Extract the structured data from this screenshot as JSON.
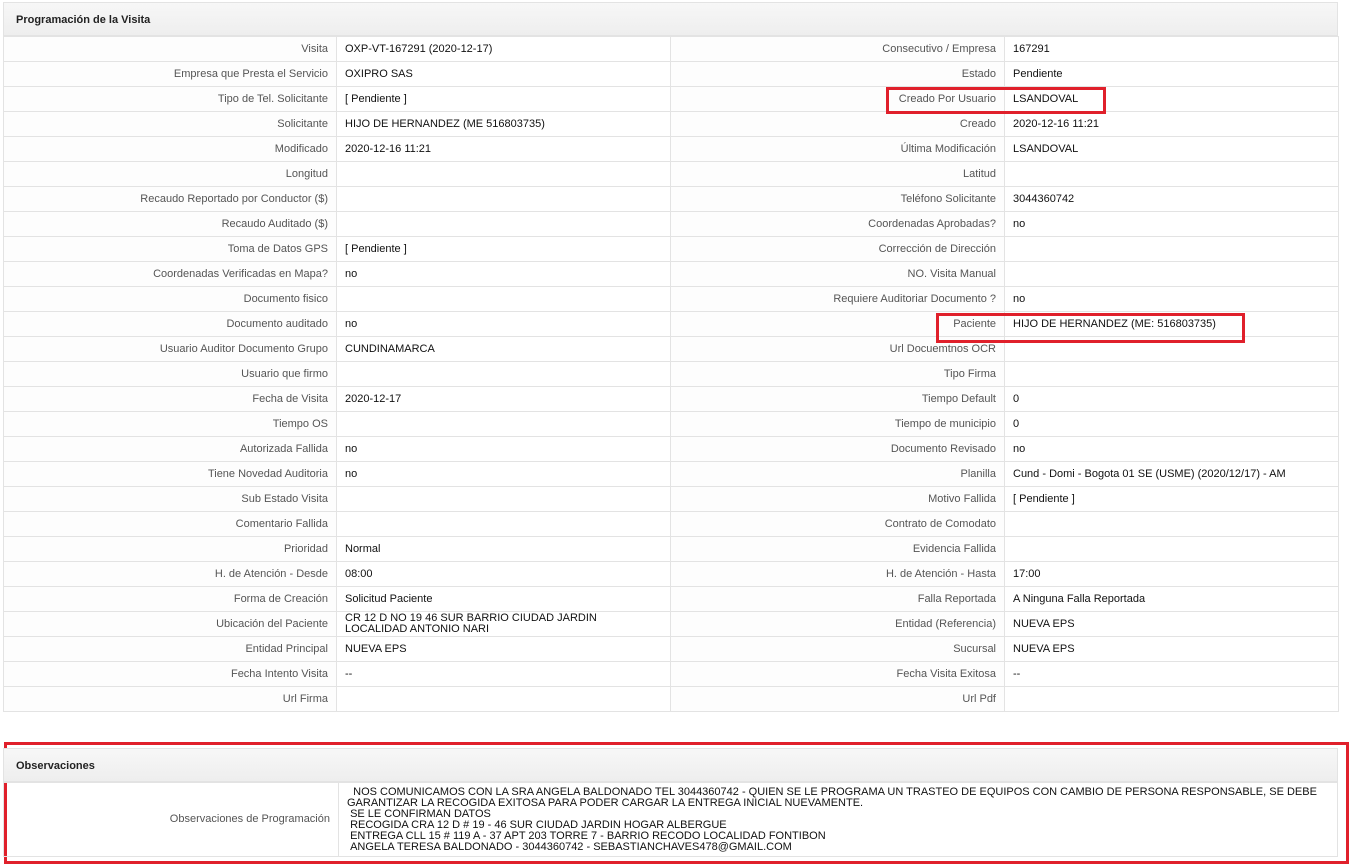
{
  "programacion": {
    "title": "Programación de la Visita",
    "rows": [
      {
        "l1": "Visita",
        "v1": "OXP-VT-167291 (2020-12-17)",
        "l2": "Consecutivo / Empresa",
        "v2": "167291"
      },
      {
        "l1": "Empresa que Presta el Servicio",
        "v1": "OXIPRO SAS",
        "l2": "Estado",
        "v2": "Pendiente"
      },
      {
        "l1": "Tipo de Tel. Solicitante",
        "v1": "[ Pendiente ]",
        "l2": "Creado Por Usuario",
        "v2": "LSANDOVAL"
      },
      {
        "l1": "Solicitante",
        "v1": "HIJO DE HERNANDEZ (ME 516803735)",
        "l2": "Creado",
        "v2": "2020-12-16 11:21"
      },
      {
        "l1": "Modificado",
        "v1": "2020-12-16 11:21",
        "l2": "Última Modificación",
        "v2": " LSANDOVAL"
      },
      {
        "l1": "Longitud",
        "v1": "",
        "l2": "Latitud",
        "v2": ""
      },
      {
        "l1": "Recaudo Reportado por Conductor ($)",
        "v1": "",
        "l2": "Teléfono Solicitante",
        "v2": "3044360742"
      },
      {
        "l1": "Recaudo Auditado ($)",
        "v1": "",
        "l2": "Coordenadas Aprobadas?",
        "v2": " no"
      },
      {
        "l1": "Toma de Datos GPS",
        "v1": "[ Pendiente ]",
        "l2": "Corrección de Dirección",
        "v2": ""
      },
      {
        "l1": "Coordenadas Verificadas en Mapa?",
        "v1": " no",
        "l2": "NO. Visita Manual",
        "v2": ""
      },
      {
        "l1": "Documento fisico",
        "v1": "",
        "l2": "Requiere Auditoriar Documento ?",
        "v2": " no"
      },
      {
        "l1": "Documento auditado",
        "v1": " no",
        "l2": "Paciente",
        "v2": "HIJO DE HERNANDEZ (ME: 516803735)"
      },
      {
        "l1": "Usuario Auditor Documento Grupo",
        "v1": "CUNDINAMARCA",
        "l2": "Url Docuemtnos OCR",
        "v2": ""
      },
      {
        "l1": "Usuario que firmo",
        "v1": "",
        "l2": "Tipo Firma",
        "v2": ""
      },
      {
        "l1": "Fecha de Visita",
        "v1": " 2020-12-17",
        "l2": "Tiempo Default",
        "v2": "0"
      },
      {
        "l1": "Tiempo OS",
        "v1": "",
        "l2": "Tiempo de municipio",
        "v2": "0"
      },
      {
        "l1": "Autorizada Fallida",
        "v1": " no",
        "l2": "Documento Revisado",
        "v2": " no"
      },
      {
        "l1": "Tiene Novedad Auditoria",
        "v1": " no",
        "l2": "Planilla",
        "v2": "Cund - Domi - Bogota 01 SE (USME) (2020/12/17) - AM"
      },
      {
        "l1": "Sub Estado Visita",
        "v1": "",
        "l2": "Motivo Fallida",
        "v2": "[ Pendiente ]"
      },
      {
        "l1": "Comentario Fallida",
        "v1": "",
        "l2": "Contrato de Comodato",
        "v2": ""
      },
      {
        "l1": "Prioridad",
        "v1": "Normal",
        "l2": "Evidencia Fallida",
        "v2": ""
      },
      {
        "l1": "H. de Atención - Desde",
        "v1": "08:00",
        "l2": "H. de Atención - Hasta",
        "v2": "17:00"
      },
      {
        "l1": "Forma de Creación",
        "v1": "Solicitud Paciente",
        "l2": "Falla Reportada",
        "v2": "A Ninguna Falla Reportada"
      },
      {
        "l1": "Ubicación del Paciente",
        "v1": "CR 12 D NO 19 46 SUR BARRIO CIUDAD JARDIN LOCALIDAD ANTONIO NARI",
        "l2": "Entidad (Referencia)",
        "v2": "NUEVA EPS"
      },
      {
        "l1": "Entidad Principal",
        "v1": "NUEVA EPS",
        "l2": "Sucursal",
        "v2": "NUEVA EPS"
      },
      {
        "l1": "Fecha Intento Visita",
        "v1": " --",
        "l2": "Fecha Visita Exitosa",
        "v2": " --"
      },
      {
        "l1": "Url Firma",
        "v1": "",
        "l2": "Url Pdf",
        "v2": ""
      }
    ]
  },
  "observaciones": {
    "title": "Observaciones",
    "label": "Observaciones de Programación",
    "text": "  NOS COMUNICAMOS CON LA SRA ANGELA BALDONADO TEL 3044360742 - QUIEN SE LE PROGRAMA UN TRASTEO DE EQUIPOS CON CAMBIO DE PERSONA RESPONSABLE, SE DEBE GARANTIZAR LA RECOGIDA EXITOSA PARA PODER CARGAR LA ENTREGA INICIAL NUEVAMENTE.\n SE LE CONFIRMAN DATOS\n RECOGIDA CRA 12 D # 19 - 46 SUR CIUDAD JARDIN HOGAR ALBERGUE\n ENTREGA CLL 15 # 119 A - 37 APT 203 TORRE 7 - BARRIO RECODO LOCALIDAD FONTIBON\n ANGELA TERESA BALDONADO - 3044360742 - SEBASTIANCHAVES478@GMAIL.COM"
  },
  "highlight_color": "#e0202b"
}
